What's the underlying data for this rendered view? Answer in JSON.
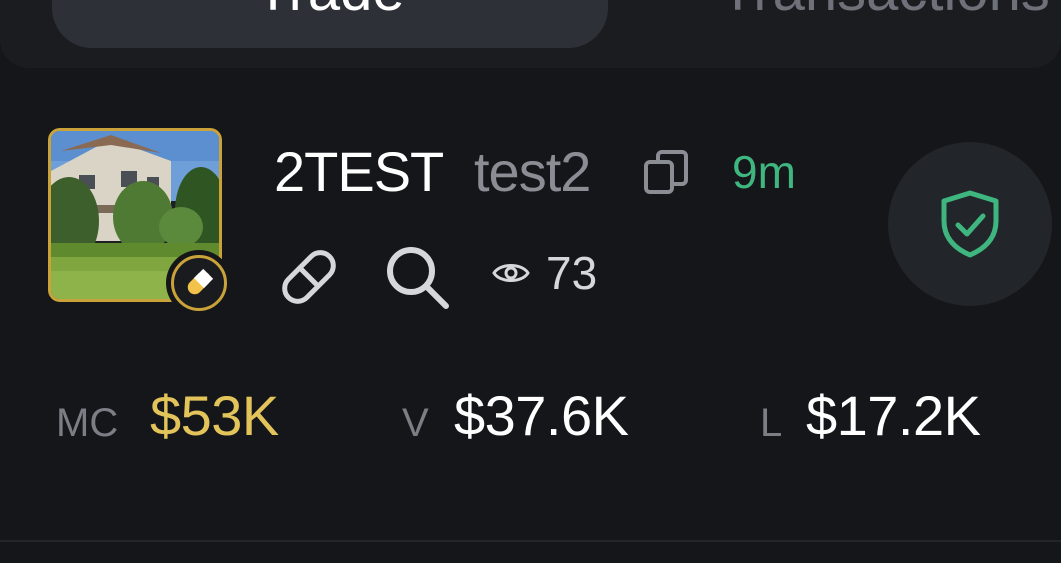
{
  "tabs": {
    "trade": "Trade",
    "transactions": "Transactions"
  },
  "token": {
    "symbol": "2TEST",
    "name": "test2",
    "age": "9m",
    "views": "73",
    "image_icon": "house-photo-thumbnail",
    "badge_icon": "pill-icon"
  },
  "stats": {
    "mc_label": "MC",
    "mc_value": "$53K",
    "v_label": "V",
    "v_value": "$37.6K",
    "l_label": "L",
    "l_value": "$17.2K"
  },
  "colors": {
    "background": "#151619",
    "accent_gold": "#c9a33a",
    "mc_value": "#e2c45a",
    "age_green": "#3fb57f",
    "shield_green": "#3fb57f"
  }
}
